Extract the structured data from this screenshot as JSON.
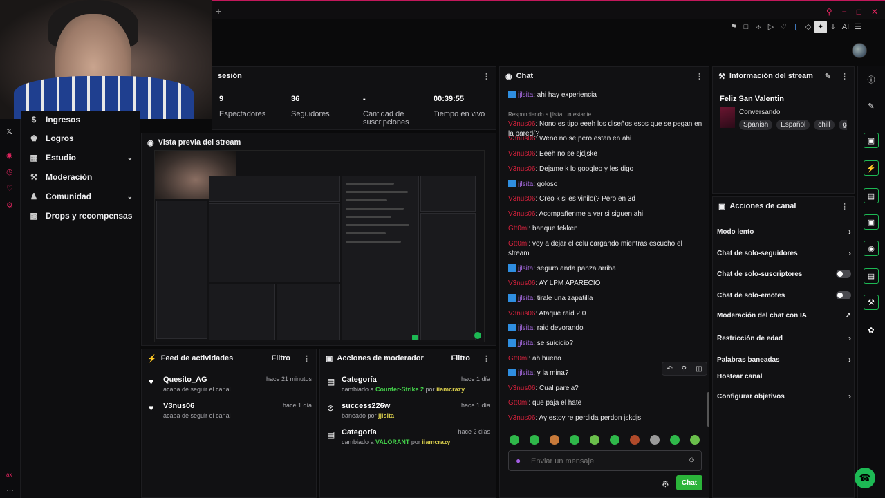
{
  "colors": {
    "accent": "#1db954",
    "brand_pink": "#e0245e",
    "purple": "#a66ae0",
    "red_user": "#d0213b",
    "link_green": "#43d04a"
  },
  "topbar": {
    "plus": "+",
    "icons": [
      "bookmark-icon",
      "square-icon",
      "shield-icon",
      "send-icon",
      "heart-icon",
      "wifi-icon",
      "puzzle-icon",
      "extension-icon",
      "download-icon",
      "translate-icon",
      "menu-icon"
    ],
    "ai_label": "AI"
  },
  "sidenav": {
    "items": [
      {
        "label": "Ingresos",
        "icon": "dollar-icon",
        "chevron": false
      },
      {
        "label": "Logros",
        "icon": "trophy-icon",
        "chevron": false
      },
      {
        "label": "Estudio",
        "icon": "film-icon",
        "chevron": true
      },
      {
        "label": "Moderación",
        "icon": "wrench-icon",
        "chevron": false
      },
      {
        "label": "Comunidad",
        "icon": "people-icon",
        "chevron": true
      },
      {
        "label": "Drops y recompensas",
        "icon": "gift-icon",
        "chevron": false
      }
    ]
  },
  "stats": {
    "title": "sesión",
    "items": [
      {
        "value": "9",
        "label": "Espectadores"
      },
      {
        "value": "36",
        "label": "Seguidores"
      },
      {
        "value": "-",
        "label": "Cantidad de suscripciones"
      },
      {
        "value": "00:39:55",
        "label": "Tiempo en vivo"
      }
    ]
  },
  "preview": {
    "title": "Vista previa del stream"
  },
  "feed": {
    "title": "Feed de actividades",
    "filter": "Filtro",
    "items": [
      {
        "name": "Quesito_AG",
        "sub": "acaba de seguir el canal",
        "time": "hace 21 minutos"
      },
      {
        "name": "V3nus06",
        "sub": "acaba de seguir el canal",
        "time": "hace 1 día"
      }
    ]
  },
  "modactions": {
    "title": "Acciones de moderador",
    "filter": "Filtro",
    "items": [
      {
        "name": "Categoría",
        "sub_pre": "cambiado a ",
        "sub_hl": "Counter-Strike 2",
        "sub_mid": " por ",
        "sub_user": "iiamcrazy",
        "time": "hace 1 día"
      },
      {
        "name": "success226w",
        "sub_pre": "baneado por ",
        "sub_hl": "",
        "sub_mid": "",
        "sub_user": "jjlsita",
        "time": "hace 1 día"
      },
      {
        "name": "Categoría",
        "sub_pre": "cambiado a ",
        "sub_hl": "VALORANT",
        "sub_mid": " por ",
        "sub_user": "iiamcrazy",
        "time": "hace 2 días"
      }
    ]
  },
  "chat": {
    "title": "Chat",
    "messages": [
      {
        "user": "jjlsita",
        "type": "j",
        "text": ": ahi hay experiencia"
      },
      {
        "reply": "Respondiendo a jjlsita: un estante..",
        "user": "V3nus06",
        "type": "v",
        "text": ": Nono es tipo eeeh los diseños esos que se pegan en la pared(?"
      },
      {
        "user": "V3nus06",
        "type": "v",
        "text": ": Weno no se pero estan en ahi"
      },
      {
        "user": "V3nus06",
        "type": "v",
        "text": ": Eeeh no se sjdjske"
      },
      {
        "user": "V3nus06",
        "type": "v",
        "text": ": Dejame k lo googleo y les digo"
      },
      {
        "user": "jjlsita",
        "type": "j",
        "text": ": goloso"
      },
      {
        "user": "V3nus06",
        "type": "v",
        "text": ": Creo k si es vinilo(? Pero en 3d"
      },
      {
        "user": "V3nus06",
        "type": "v",
        "text": ": Acompañenme a ver si siguen ahi"
      },
      {
        "user": "Gtt0ml",
        "type": "g",
        "text": ": banque tekken"
      },
      {
        "user": "Gtt0ml",
        "type": "g",
        "text": ": voy a dejar el celu cargando mientras escucho el stream"
      },
      {
        "user": "jjlsita",
        "type": "j",
        "text": ": seguro anda panza arriba"
      },
      {
        "user": "V3nus06",
        "type": "v",
        "text": ": AY LPM APARECIO"
      },
      {
        "user": "jjlsita",
        "type": "j",
        "text": ": tirale una zapatilla"
      },
      {
        "user": "V3nus06",
        "type": "v",
        "text": ": Ataque raid 2.0"
      },
      {
        "user": "jjlsita",
        "type": "j",
        "text": ": raid devorando"
      },
      {
        "user": "jjlsita",
        "type": "j",
        "text": ": se suicidio?"
      },
      {
        "user": "Gtt0ml",
        "type": "g",
        "text": ": ah bueno"
      },
      {
        "user": "jjlsita",
        "type": "j",
        "text": ": y la mina?"
      },
      {
        "user": "V3nus06",
        "type": "v",
        "text": ": Cual pareja?"
      },
      {
        "user": "Gtt0ml",
        "type": "g",
        "text": ": que paja el hate"
      },
      {
        "user": "V3nus06",
        "type": "v",
        "text": ": Ay estoy re perdida perdon jskdjs"
      }
    ],
    "input_placeholder": "Enviar un mensaje",
    "send_label": "Chat"
  },
  "info": {
    "title": "Información del stream",
    "stream_title": "Feliz San Valentin",
    "category": "Conversando",
    "tags": [
      "Spanish",
      "Español",
      "chill",
      "gar"
    ]
  },
  "channel_actions": {
    "title": "Acciones de canal",
    "rows": [
      {
        "label": "Modo lento",
        "kind": "arrow"
      },
      {
        "label": "Chat de solo-seguidores",
        "kind": "arrow"
      },
      {
        "label": "Chat de solo-suscriptores",
        "kind": "toggle"
      },
      {
        "label": "Chat de solo-emotes",
        "kind": "toggle"
      },
      {
        "label": "Moderación del chat con IA",
        "kind": "external"
      },
      {
        "label": "Restricción de edad",
        "kind": "arrow"
      },
      {
        "label": "Palabras baneadas",
        "kind": "arrow"
      },
      {
        "label": "Hostear canal",
        "kind": "none"
      },
      {
        "label": "Configurar objetivos",
        "kind": "arrow"
      }
    ]
  }
}
